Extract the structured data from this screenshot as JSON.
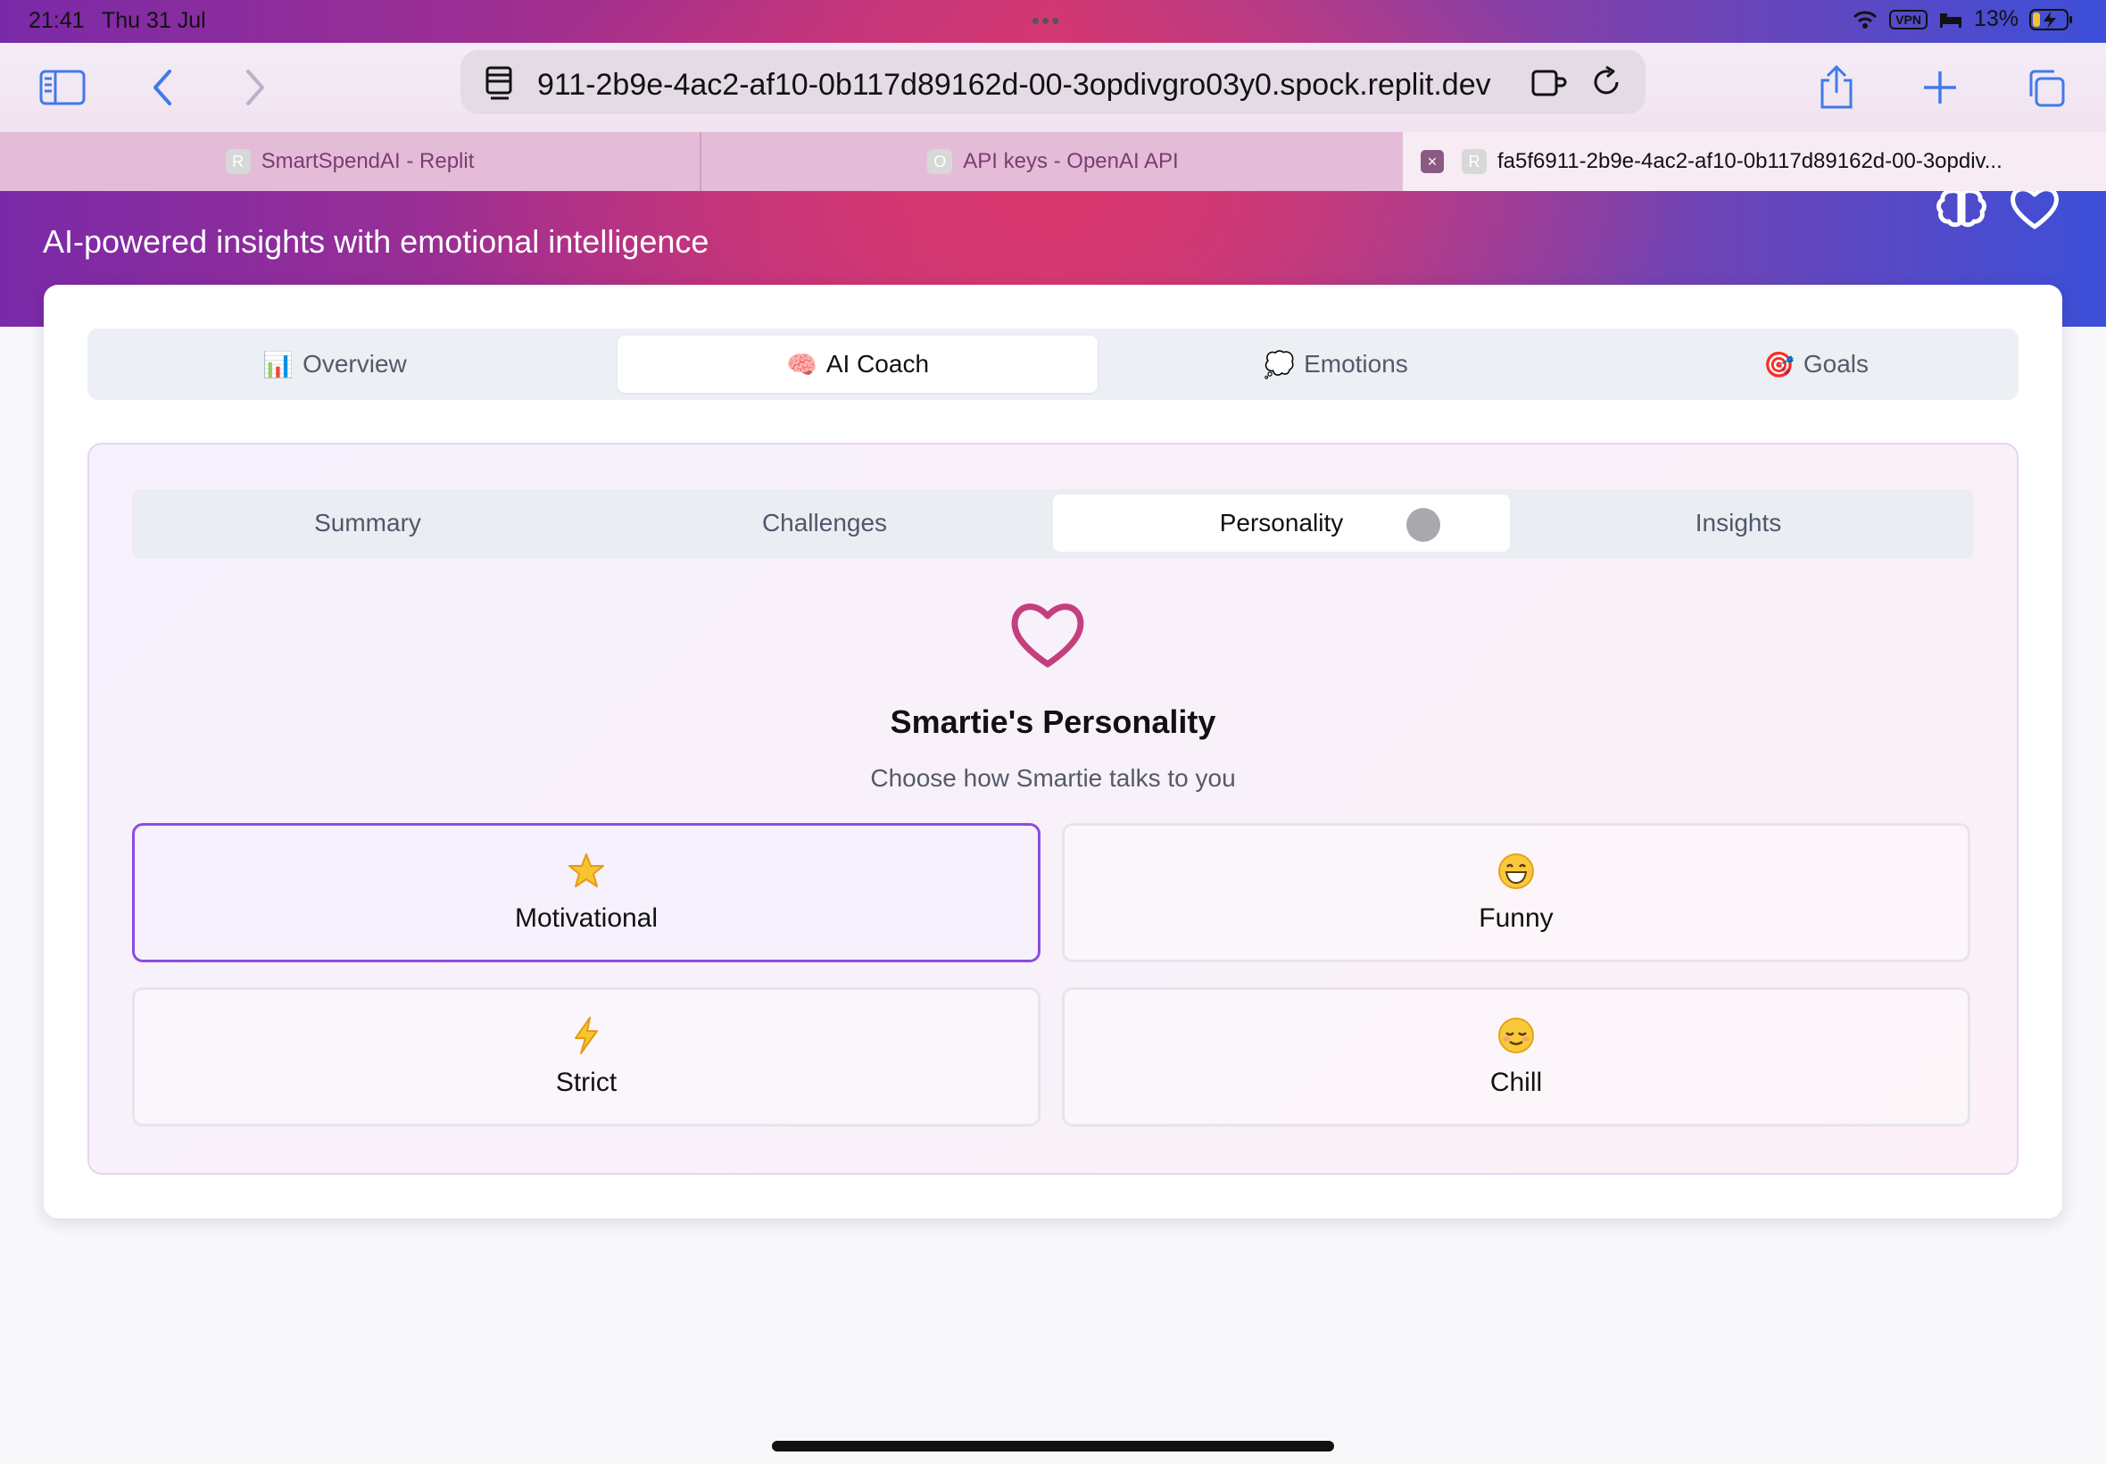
{
  "status_bar": {
    "time": "21:41",
    "date": "Thu 31 Jul",
    "vpn": "VPN",
    "battery": "13%"
  },
  "browser": {
    "url": "911-2b9e-4ac2-af10-0b117d89162d-00-3opdivgro03y0.spock.replit.dev",
    "tabs": [
      {
        "favicon": "R",
        "title": "SmartSpendAI - Replit"
      },
      {
        "favicon": "O",
        "title": "API keys - OpenAI API"
      },
      {
        "favicon": "R",
        "title": "fa5f6911-2b9e-4ac2-af10-0b117d89162d-00-3opdiv..."
      }
    ]
  },
  "header": {
    "subtitle": "AI-powered insights with emotional intelligence"
  },
  "main_tabs": [
    {
      "icon": "📊",
      "label": "Overview"
    },
    {
      "icon": "🧠",
      "label": "AI Coach"
    },
    {
      "icon": "💭",
      "label": "Emotions"
    },
    {
      "icon": "🎯",
      "label": "Goals"
    }
  ],
  "active_main_tab": "AI Coach",
  "sub_tabs": [
    "Summary",
    "Challenges",
    "Personality",
    "Insights"
  ],
  "active_sub_tab": "Personality",
  "personality": {
    "title": "Smartie's Personality",
    "subtitle": "Choose how Smartie talks to you",
    "options": [
      {
        "icon": "star-icon",
        "label": "Motivational",
        "selected": true
      },
      {
        "icon": "grinning-face-icon",
        "label": "Funny",
        "selected": false
      },
      {
        "icon": "lightning-icon",
        "label": "Strict",
        "selected": false
      },
      {
        "icon": "relieved-face-icon",
        "label": "Chill",
        "selected": false
      }
    ]
  },
  "colors": {
    "accent": "#8b4ee0",
    "heart": "#c43f7e",
    "browser_accent": "#3f7be8"
  }
}
